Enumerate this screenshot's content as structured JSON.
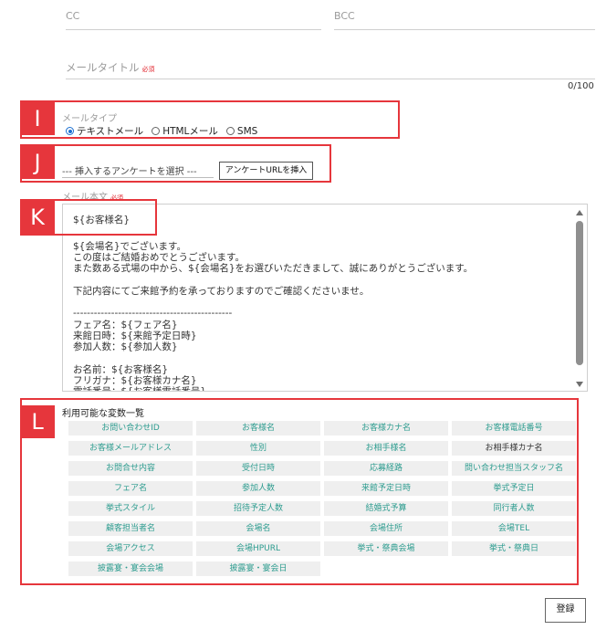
{
  "cc": {
    "label": "CC"
  },
  "bcc": {
    "label": "BCC"
  },
  "mail_title": {
    "label": "メールタイトル",
    "required": "必須",
    "counter": "0/100"
  },
  "mail_type": {
    "label": "メールタイプ",
    "options": [
      "テキストメール",
      "HTMLメール",
      "SMS"
    ],
    "selected": "テキストメール"
  },
  "survey": {
    "placeholder": "--- 挿入するアンケートを選択 ---",
    "insert_button": "アンケートURLを挿入"
  },
  "mail_body": {
    "label": "メール本文",
    "required": "必須",
    "lines": [
      "${お客様名}",
      "",
      "${会場名}でございます。",
      "この度はご結婚おめでとうございます。",
      "また数ある式場の中から、${会場名}をお選びいただきまして、誠にありがとうございます。",
      "",
      "下記内容にてご来館予約を承っておりますのでご確認くださいませ。",
      "",
      "----------------------------------------------",
      "フェア名：${フェア名}",
      "来館日時：${来館予定日時}",
      "参加人数：${参加人数}",
      "",
      "お名前：${お客様名}",
      "フリガナ：${お客様カナ名}",
      "電話番号：${お客様電話番号}"
    ]
  },
  "variables": {
    "title": "利用可能な変数一覧",
    "items": [
      "お問い合わせID",
      "お客様名",
      "お客様カナ名",
      "お客様電話番号",
      "お客様メールアドレス",
      "性別",
      "お相手様名",
      "お相手様カナ名",
      "お問合せ内容",
      "受付日時",
      "応募経路",
      "問い合わせ担当スタッフ名",
      "フェア名",
      "参加人数",
      "来館予定日時",
      "挙式予定日",
      "挙式スタイル",
      "招待予定人数",
      "結婚式予算",
      "同行者人数",
      "顧客担当者名",
      "会場名",
      "会場住所",
      "会場TEL",
      "会場アクセス",
      "会場HPURL",
      "挙式・祭典会場",
      "挙式・祭典日",
      "披露宴・宴会会場",
      "披露宴・宴会日"
    ]
  },
  "annotations": {
    "I": "I",
    "J": "J",
    "K": "K",
    "L": "L"
  },
  "submit_label": "登録",
  "colors": {
    "annotation": "#e6363c",
    "chip_text": "#2d9c8f",
    "radio_on": "#1b6fd1"
  }
}
